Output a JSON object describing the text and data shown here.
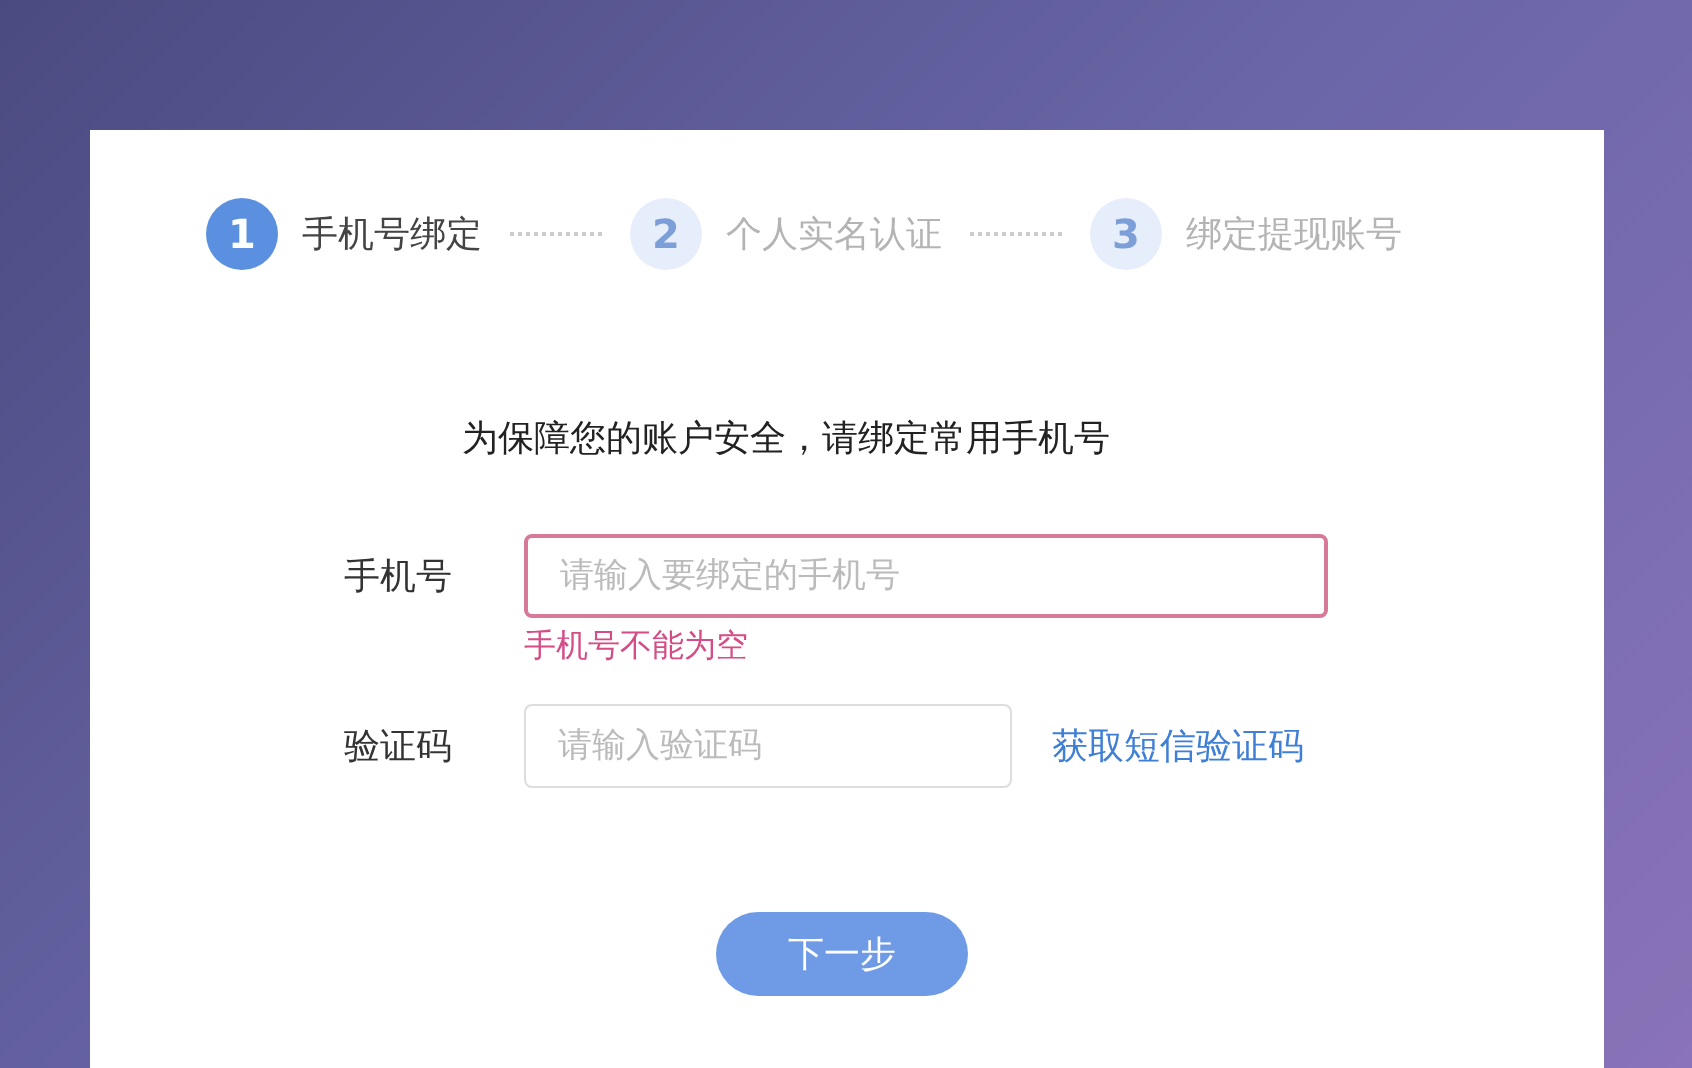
{
  "steps": [
    {
      "number": "1",
      "label": "手机号绑定",
      "selected": true
    },
    {
      "number": "2",
      "label": "个人实名认证",
      "selected": false
    },
    {
      "number": "3",
      "label": "绑定提现账号",
      "selected": false
    }
  ],
  "heading": "为保障您的账户安全，请绑定常用手机号",
  "fields": [
    {
      "label": "手机号",
      "placeholder": "请输入要绑定的手机号",
      "error": "手机号不能为空"
    },
    {
      "label": "验证码",
      "placeholder": "请输入验证码",
      "action": "获取短信验证码"
    }
  ],
  "next_button": "下一步"
}
